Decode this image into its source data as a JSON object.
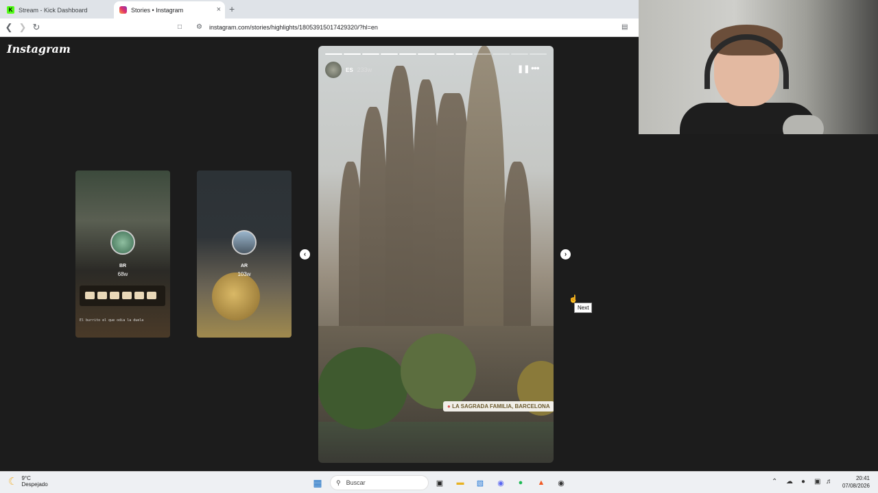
{
  "browser": {
    "tabs": [
      {
        "title": "Stream - Kick Dashboard",
        "favicon": "kick-icon",
        "active": false
      },
      {
        "title": "Stories • Instagram",
        "favicon": "instagram-icon",
        "active": true
      }
    ],
    "tab_close": "×",
    "new_tab": "+",
    "url": "instagram.com/stories/highlights/18053915017429320/?hl=en"
  },
  "page": {
    "logo": "Instagram",
    "prev_story_thumbs": [
      {
        "user": "BR",
        "time": "68w",
        "caption": "El burrito el que odia la duela"
      },
      {
        "user": "AR",
        "time": "103w"
      }
    ],
    "story": {
      "user": "ES",
      "time": "233w",
      "segments_total": 12,
      "segments_viewed": 8,
      "location": "LA SAGRADA FAMILIA, BARCELONA"
    },
    "tooltip": "Next"
  },
  "taskbar": {
    "weather_temp": "9°C",
    "weather_desc": "Despejado",
    "search_label": "Buscar",
    "time": "20:41",
    "date": "07/08/2026"
  },
  "colors": {
    "page_bg": "#1c1c1c",
    "kick_green": "#53fc18",
    "instagram_gradient": [
      "#f9a13a",
      "#e1306c",
      "#833ab4"
    ]
  }
}
